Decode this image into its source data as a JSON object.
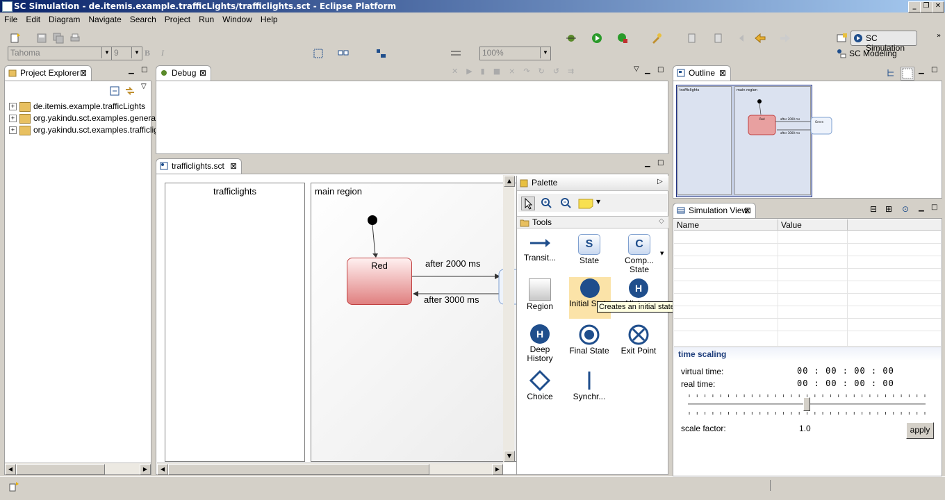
{
  "window": {
    "title": "SC Simulation - de.itemis.example.trafficLights/trafficlights.sct - Eclipse Platform",
    "buttons": [
      "_",
      "❐",
      "✕"
    ]
  },
  "menu": [
    "File",
    "Edit",
    "Diagram",
    "Navigate",
    "Search",
    "Project",
    "Run",
    "Window",
    "Help"
  ],
  "toolbar": {
    "font_name": "Tahoma",
    "font_size": "9",
    "zoom": "100%",
    "bold": "B",
    "italic": "I"
  },
  "perspectives": {
    "active": "SC Simulation",
    "other": "SC Modeling"
  },
  "project_explorer": {
    "tab": "Project Explorer",
    "projects": [
      "de.itemis.example.trafficLights",
      "org.yakindu.sct.examples.generat",
      "org.yakindu.sct.examples.trafficlig"
    ]
  },
  "debug": {
    "tab": "Debug"
  },
  "editor": {
    "tab": "trafficlights.sct",
    "left_region_title": "trafficlights",
    "main_region_title": "main region",
    "state_red": "Red",
    "transition_1": "after 2000 ms",
    "transition_2": "after 3000 ms"
  },
  "palette": {
    "title": "Palette",
    "drawer": "Tools",
    "tooltip": "Creates an initial state",
    "items": [
      {
        "label": "Transit...",
        "icon": "transition-arrow-icon"
      },
      {
        "label": "State",
        "icon": "state-icon",
        "letter": "S"
      },
      {
        "label": "Comp... State",
        "icon": "composite-state-icon",
        "letter": "C"
      },
      {
        "label": "Region",
        "icon": "region-icon"
      },
      {
        "label": "Initial State",
        "icon": "initial-state-icon"
      },
      {
        "label": "History",
        "icon": "history-icon",
        "letter": "H"
      },
      {
        "label": "Deep History",
        "icon": "deep-history-icon",
        "letter": "H"
      },
      {
        "label": "Final State",
        "icon": "final-state-icon"
      },
      {
        "label": "Exit Point",
        "icon": "exit-point-icon"
      },
      {
        "label": "Choice",
        "icon": "choice-icon"
      },
      {
        "label": "Synchr...",
        "icon": "synchronization-icon"
      }
    ]
  },
  "outline": {
    "tab": "Outline",
    "mini_left": "trafficlights",
    "mini_main": "main region",
    "mini_red": "Red",
    "mini_green": "Green",
    "mini_t1": "after 2000 ms",
    "mini_t2": "after 3000 ms"
  },
  "simulation": {
    "tab": "Simulation View",
    "col_name": "Name",
    "col_value": "Value",
    "time_scaling_title": "time scaling",
    "virtual_time_label": "virtual time:",
    "virtual_time_value": "00 : 00 : 00 : 00",
    "real_time_label": "real time:",
    "real_time_value": "00 : 00 : 00 : 00",
    "scale_factor_label": "scale factor:",
    "scale_factor_value": "1.0",
    "slider_position": 0.5,
    "apply": "apply"
  },
  "colors": {
    "title_start": "#0a246a",
    "title_end": "#a6caf0",
    "state_border": "#c04040",
    "palette_icon": "#1f4e8c",
    "selected_tool": "#fbe3a8"
  }
}
